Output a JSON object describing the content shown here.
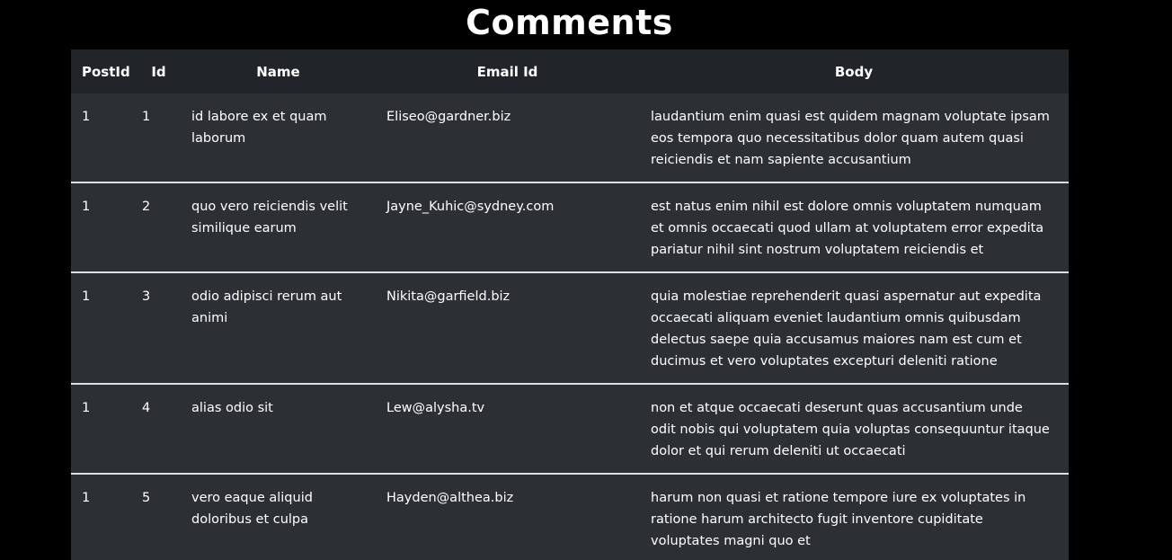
{
  "page": {
    "title": "Comments"
  },
  "table": {
    "headers": {
      "postid": "PostId",
      "id": "Id",
      "name": "Name",
      "email": "Email Id",
      "body": "Body"
    },
    "rows": [
      {
        "postId": "1",
        "id": "1",
        "name": "id labore ex et quam laborum",
        "email": "Eliseo@gardner.biz",
        "body": "laudantium enim quasi est quidem magnam voluptate ipsam eos tempora quo necessitatibus dolor quam autem quasi reiciendis et nam sapiente accusantium"
      },
      {
        "postId": "1",
        "id": "2",
        "name": "quo vero reiciendis velit similique earum",
        "email": "Jayne_Kuhic@sydney.com",
        "body": "est natus enim nihil est dolore omnis voluptatem numquam et omnis occaecati quod ullam at voluptatem error expedita pariatur nihil sint nostrum voluptatem reiciendis et"
      },
      {
        "postId": "1",
        "id": "3",
        "name": "odio adipisci rerum aut animi",
        "email": "Nikita@garfield.biz",
        "body": "quia molestiae reprehenderit quasi aspernatur aut expedita occaecati aliquam eveniet laudantium omnis quibusdam delectus saepe quia accusamus maiores nam est cum et ducimus et vero voluptates excepturi deleniti ratione"
      },
      {
        "postId": "1",
        "id": "4",
        "name": "alias odio sit",
        "email": "Lew@alysha.tv",
        "body": "non et atque occaecati deserunt quas accusantium unde odit nobis qui voluptatem quia voluptas consequuntur itaque dolor et qui rerum deleniti ut occaecati"
      },
      {
        "postId": "1",
        "id": "5",
        "name": "vero eaque aliquid doloribus et culpa",
        "email": "Hayden@althea.biz",
        "body": "harum non quasi et ratione tempore iure ex voluptates in ratione harum architecto fugit inventore cupiditate voluptates magni quo et"
      }
    ]
  },
  "colors": {
    "page_background": "#000000",
    "header_background": "#212529",
    "row_background": "#2c3034",
    "row_divider": "#dee2e6",
    "text": "#ffffff"
  }
}
